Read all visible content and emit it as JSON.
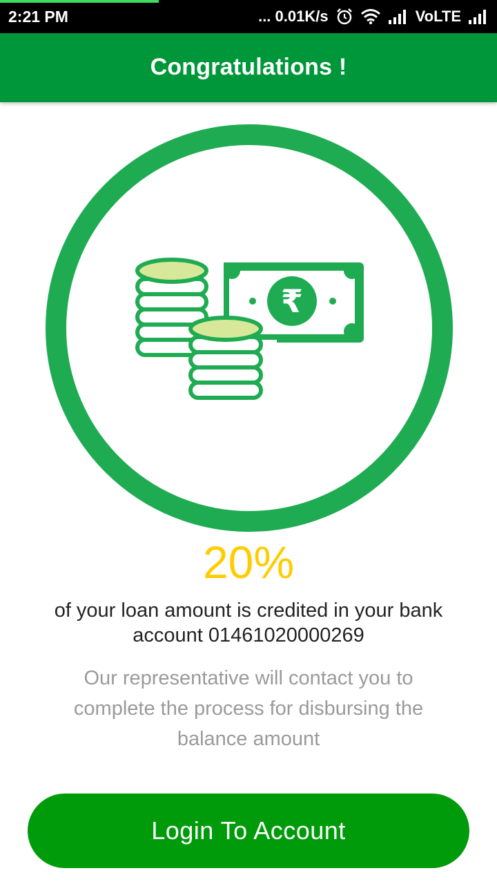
{
  "status_bar": {
    "time": "2:21 PM",
    "network_speed": "... 0.01K/s",
    "network_type": "VoLTE",
    "icons": [
      "alarm-icon",
      "wifi-icon",
      "signal-icon",
      "signal-icon"
    ]
  },
  "header": {
    "title": "Congratulations !"
  },
  "hero": {
    "icon": "coins-and-rupee-note-icon",
    "note_symbol": "₹"
  },
  "loan": {
    "percent": "20%",
    "credit_line1": "of your loan amount is credited in your bank",
    "credit_line2": "account 01461020000269",
    "info_line1": "Our representative will contact you to",
    "info_line2": "complete the process for disbursing the",
    "info_line3": "balance amount"
  },
  "actions": {
    "login_label": "Login To Account"
  },
  "colors": {
    "primary_green": "#00963a",
    "button_green": "#009b0a",
    "ring_green": "#1fab52",
    "percent_yellow": "#ffcc00",
    "coin_fill": "#d7e89a"
  }
}
